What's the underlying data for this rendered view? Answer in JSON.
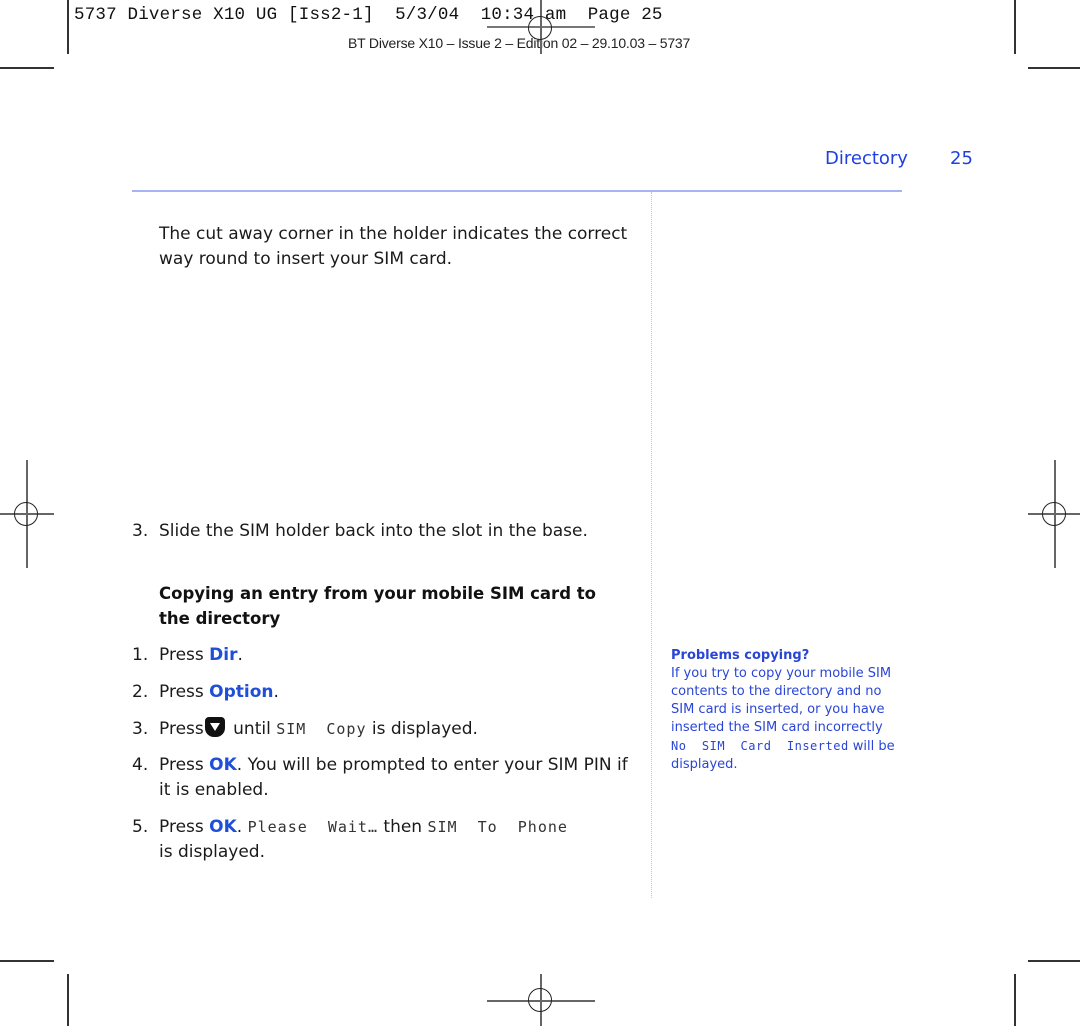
{
  "slug_line": {
    "file": "5737 Diverse X10 UG [Iss2-1]",
    "date": "5/3/04",
    "time": "10:34 am",
    "page": "Page 25"
  },
  "edition_line": "BT Diverse X10 – Issue 2 – Edition 02 – 29.10.03 – 5737",
  "running_head": {
    "section": "Directory",
    "page_number": "25"
  },
  "intro_paragraph": "The cut away corner in the holder indicates the correct way round to insert your SIM card.",
  "prev_step": {
    "number": "3.",
    "text": "Slide the SIM holder back into the slot in the base."
  },
  "section_heading": "Copying an entry from your mobile SIM card to the directory",
  "steps": [
    {
      "number": "1.",
      "prefix": "Press ",
      "key": "Dir",
      "suffix": "."
    },
    {
      "number": "2.",
      "prefix": "Press ",
      "key": "Option",
      "suffix": "."
    },
    {
      "number": "3.",
      "prefix": "Press",
      "icon": "down-arrow-key-icon",
      "mid": " until ",
      "display": "SIM  Copy",
      "suffix": " is displayed."
    },
    {
      "number": "4.",
      "prefix": "Press ",
      "key": "OK",
      "suffix": ". You will be prompted to enter your SIM PIN if it is enabled."
    },
    {
      "number": "5.",
      "prefix": "Press ",
      "key": "OK",
      "mid": ". ",
      "display": "Please  Wait…",
      "mid2": " then ",
      "display2": "SIM  To  Phone",
      "suffix": " is displayed."
    }
  ],
  "sidenote": {
    "title": "Problems copying?",
    "text": "If you try to copy your mobile SIM contents to the directory and no SIM card is inserted, or you have inserted the SIM card incorrectly ",
    "display": "No  SIM  Card  Inserted",
    "suffix": " will be displayed."
  },
  "colors": {
    "accent_blue": "#1f4fd8",
    "rule_blue": "#a9b3f4",
    "body_text": "#1a1a1a"
  }
}
